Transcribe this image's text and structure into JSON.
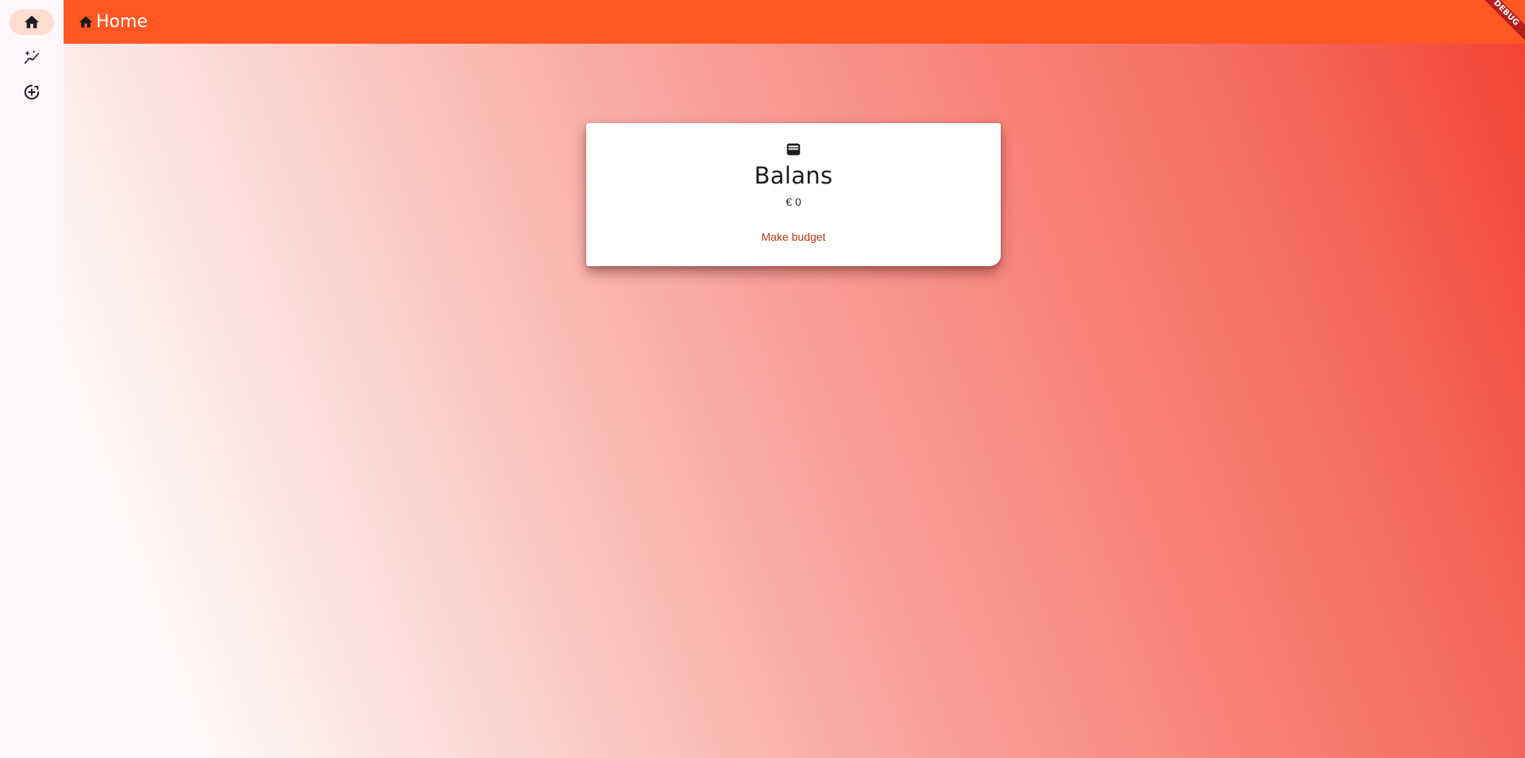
{
  "nav": {
    "items": [
      {
        "icon": "home-icon",
        "active": true
      },
      {
        "icon": "auto-graph-icon",
        "active": false
      },
      {
        "icon": "add-circle-icon",
        "active": false
      }
    ]
  },
  "app_bar": {
    "icon": "home-icon",
    "title": "Home",
    "banner": "DEBUG"
  },
  "card": {
    "icon": "wallet-icon",
    "title": "Balans",
    "amount": "€ 0",
    "button_label": "Make budget"
  },
  "colors": {
    "primary": "#ff5722",
    "nav_active": "#ffdbd0",
    "button_text": "#c0360e",
    "gradient_start": "#fef9f9",
    "gradient_end": "#f44336"
  }
}
